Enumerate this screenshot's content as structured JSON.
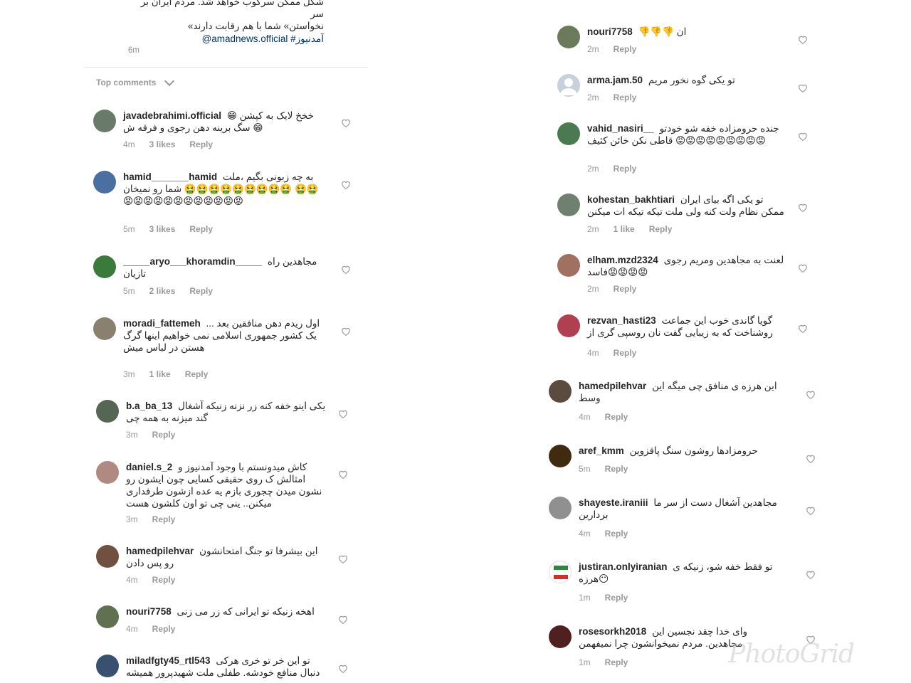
{
  "caption": {
    "line1": "شکل ممکن سرکوب خواهد شد. مردم ایران بر سر",
    "line2": "«نخواستن» شما با هم رقابت دارند",
    "tags": "@amadnews.official #آمدنیوز",
    "time": "6m"
  },
  "top_comments_label": "Top comments",
  "reply_label": "Reply",
  "left_comments": [
    {
      "user": "javadebrahimi.official",
      "text": "خخخ لایک به کپشن 😁سگ برینه دهن رجوی و فرقه ش 😁",
      "time": "4m",
      "likes": "3 likes"
    },
    {
      "user": "hamid_______hamid",
      "text": "به چه زبونی بگیم ،ملت 🤮🤮🤮🤮🤮🤮🤮🤮🤮 شما رو نمیخان 🤮🤮😡😡😡😡😡😡😡😡😡😡😡😡",
      "time": "5m",
      "likes": "3 likes"
    },
    {
      "user": "_____aryo___khoramdin_____",
      "text": "مجاهدین راه تازیان",
      "time": "5m",
      "likes": "2 likes"
    },
    {
      "user": "moradi_fattemeh",
      "text": "اول ریدم دهن منافقین بعد ... یک کشور جمهوری اسلامی نمی خواهیم اینها گرگ هستن در لباس میش",
      "time": "3m",
      "likes": "1 like"
    },
    {
      "user": "b.a_ba_13",
      "text": "یکی اینو خفه کنه زر نزنه زنیکه آشغال گند میزنه به همه چی",
      "time": "3m",
      "likes": ""
    },
    {
      "user": "daniel.s_2",
      "text": "کاش میدونستم با وجود آمدنیوز و امثالش ک روی حقیقی کسایی چون ایشون رو نشون میدن چجوری بازم یه عده ازشون طرفداری میکنن.. ینی چی تو اون کلشون هست",
      "time": "3m",
      "likes": ""
    },
    {
      "user": "hamedpilehvar",
      "text": "این بیشرفا تو جنگ امتحانشون رو پس دادن",
      "time": "4m",
      "likes": ""
    },
    {
      "user": "nouri7758",
      "text": "اهخه زنیکه تو ایرانی که زر می زنی",
      "time": "4m",
      "likes": ""
    },
    {
      "user": "miladfgty45_rtl543",
      "text": "تو این خر تو خری هرکی دنبال منافع خودشه. طفلی ملت شهیدپرور همیشه",
      "time": "",
      "likes": ""
    }
  ],
  "right_comments": [
    {
      "user": "nouri7758",
      "text": "👎👎👎 ان",
      "time": "2m",
      "likes": ""
    },
    {
      "user": "arma.jam.50",
      "text": "تو یکی گوه نخور مریم",
      "time": "2m",
      "likes": ""
    },
    {
      "user": "vahid_nasiri__",
      "text": "جنده حرومزاده خفه شو خودتو قاطی نکن خائن کثیف 😡😡😡😡😡😡😡😡😡",
      "time": "2m",
      "likes": ""
    },
    {
      "user": "kohestan_bakhtiari",
      "text": "تو یکی اگه بیای ایران ممکن نظام ولت کنه ولی ملت تیکه تیکه ات میکنن",
      "time": "2m",
      "likes": "1 like"
    },
    {
      "user": "elham.mzd2324",
      "text": "لعنت به مجاهدین ومریم رجوی فاسد😡😡😡😡",
      "time": "2m",
      "likes": ""
    },
    {
      "user": "rezvan_hasti23",
      "text": "گویا گاندی خوب این جماعت روشناخت که به زیبایی گفت نان روسپی گری از",
      "time": "4m",
      "likes": ""
    },
    {
      "user": "hamedpilehvar",
      "text": "این هرزه ی منافق چی میگه این وسط",
      "time": "4m",
      "likes": ""
    },
    {
      "user": "aref_kmm",
      "text": "حرومزادها روشون سنگ پاقزوین",
      "time": "5m",
      "likes": ""
    },
    {
      "user": "shayeste.iraniii",
      "text": "مجاهدین آشغال دست از سر ما بردارین",
      "time": "4m",
      "likes": ""
    },
    {
      "user": "justiran.onlyiranian",
      "text": "تو فقط خفه شو، زنیکه ی هرزه😶",
      "time": "1m",
      "likes": ""
    },
    {
      "user": "rosesorkh2018",
      "text": "وای خدا چقد نجسین این مجاهدین. مردم نمیخوانشون چرا نمیفهمن",
      "time": "1m",
      "likes": ""
    }
  ],
  "watermark": "PhotoGrid",
  "colors": {
    "text": "#262626",
    "muted": "#999999",
    "link": "#003569",
    "divider": "#e6e6e6"
  }
}
